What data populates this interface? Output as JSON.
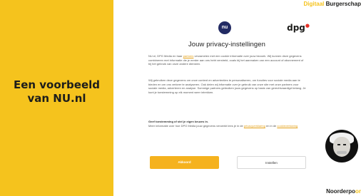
{
  "left_panel": {
    "line1": "Een voorbeeld",
    "line2": "van NU.nl"
  },
  "brand": {
    "accent": "Digitaal",
    "main": "Burgerschap"
  },
  "footer_brand": {
    "main": "Noorderpo",
    "accent": "or"
  },
  "dialog": {
    "nu_logo": "nu",
    "dpg_logo": "dpg",
    "title": "Jouw privacy-instellingen",
    "para1_prefix": "NU.nl, DPG Media en haar",
    "para1_link": "partners",
    "para1_rest": "verzamelen met een cookie informatie over jouw bezoek. Wij kunnen deze gegevens combineren met informatie die je eerder aan ons hebt verstrekt, zoals bij het aanmaken van een account of abonnement of bij het gebruik van onze andere diensten.",
    "para2": "Wij gebruiken deze gegevens om onze content en advertenties te personaliseren, om functies voor sociale media aan te bieden en om ons verkeer te analyseren. Ook delen wij informatie over je gebruik van onze site met onze partners voor sociale media, adverteren en analyse. Sommige partners gebruiken jouw gegevens op basis van gerechtvaardigd belang. Je kunt je toestemming op elk moment weer intrekken.",
    "para3_head": "Geef toestemming of stel je eigen keuzes in.",
    "para3_prefix": "Meer informatie over hoe DPG Media jouw gegevens verwerkt lees je in de",
    "para3_link1": "privacyverklaring",
    "para3_mid": "en in de",
    "para3_link2": "cookieverklaring",
    "accept_label": "Akkoord",
    "settings_label": "Instellen"
  },
  "colors": {
    "accent": "#f5c31d",
    "button": "#f5b21e",
    "link": "#e39e12"
  }
}
